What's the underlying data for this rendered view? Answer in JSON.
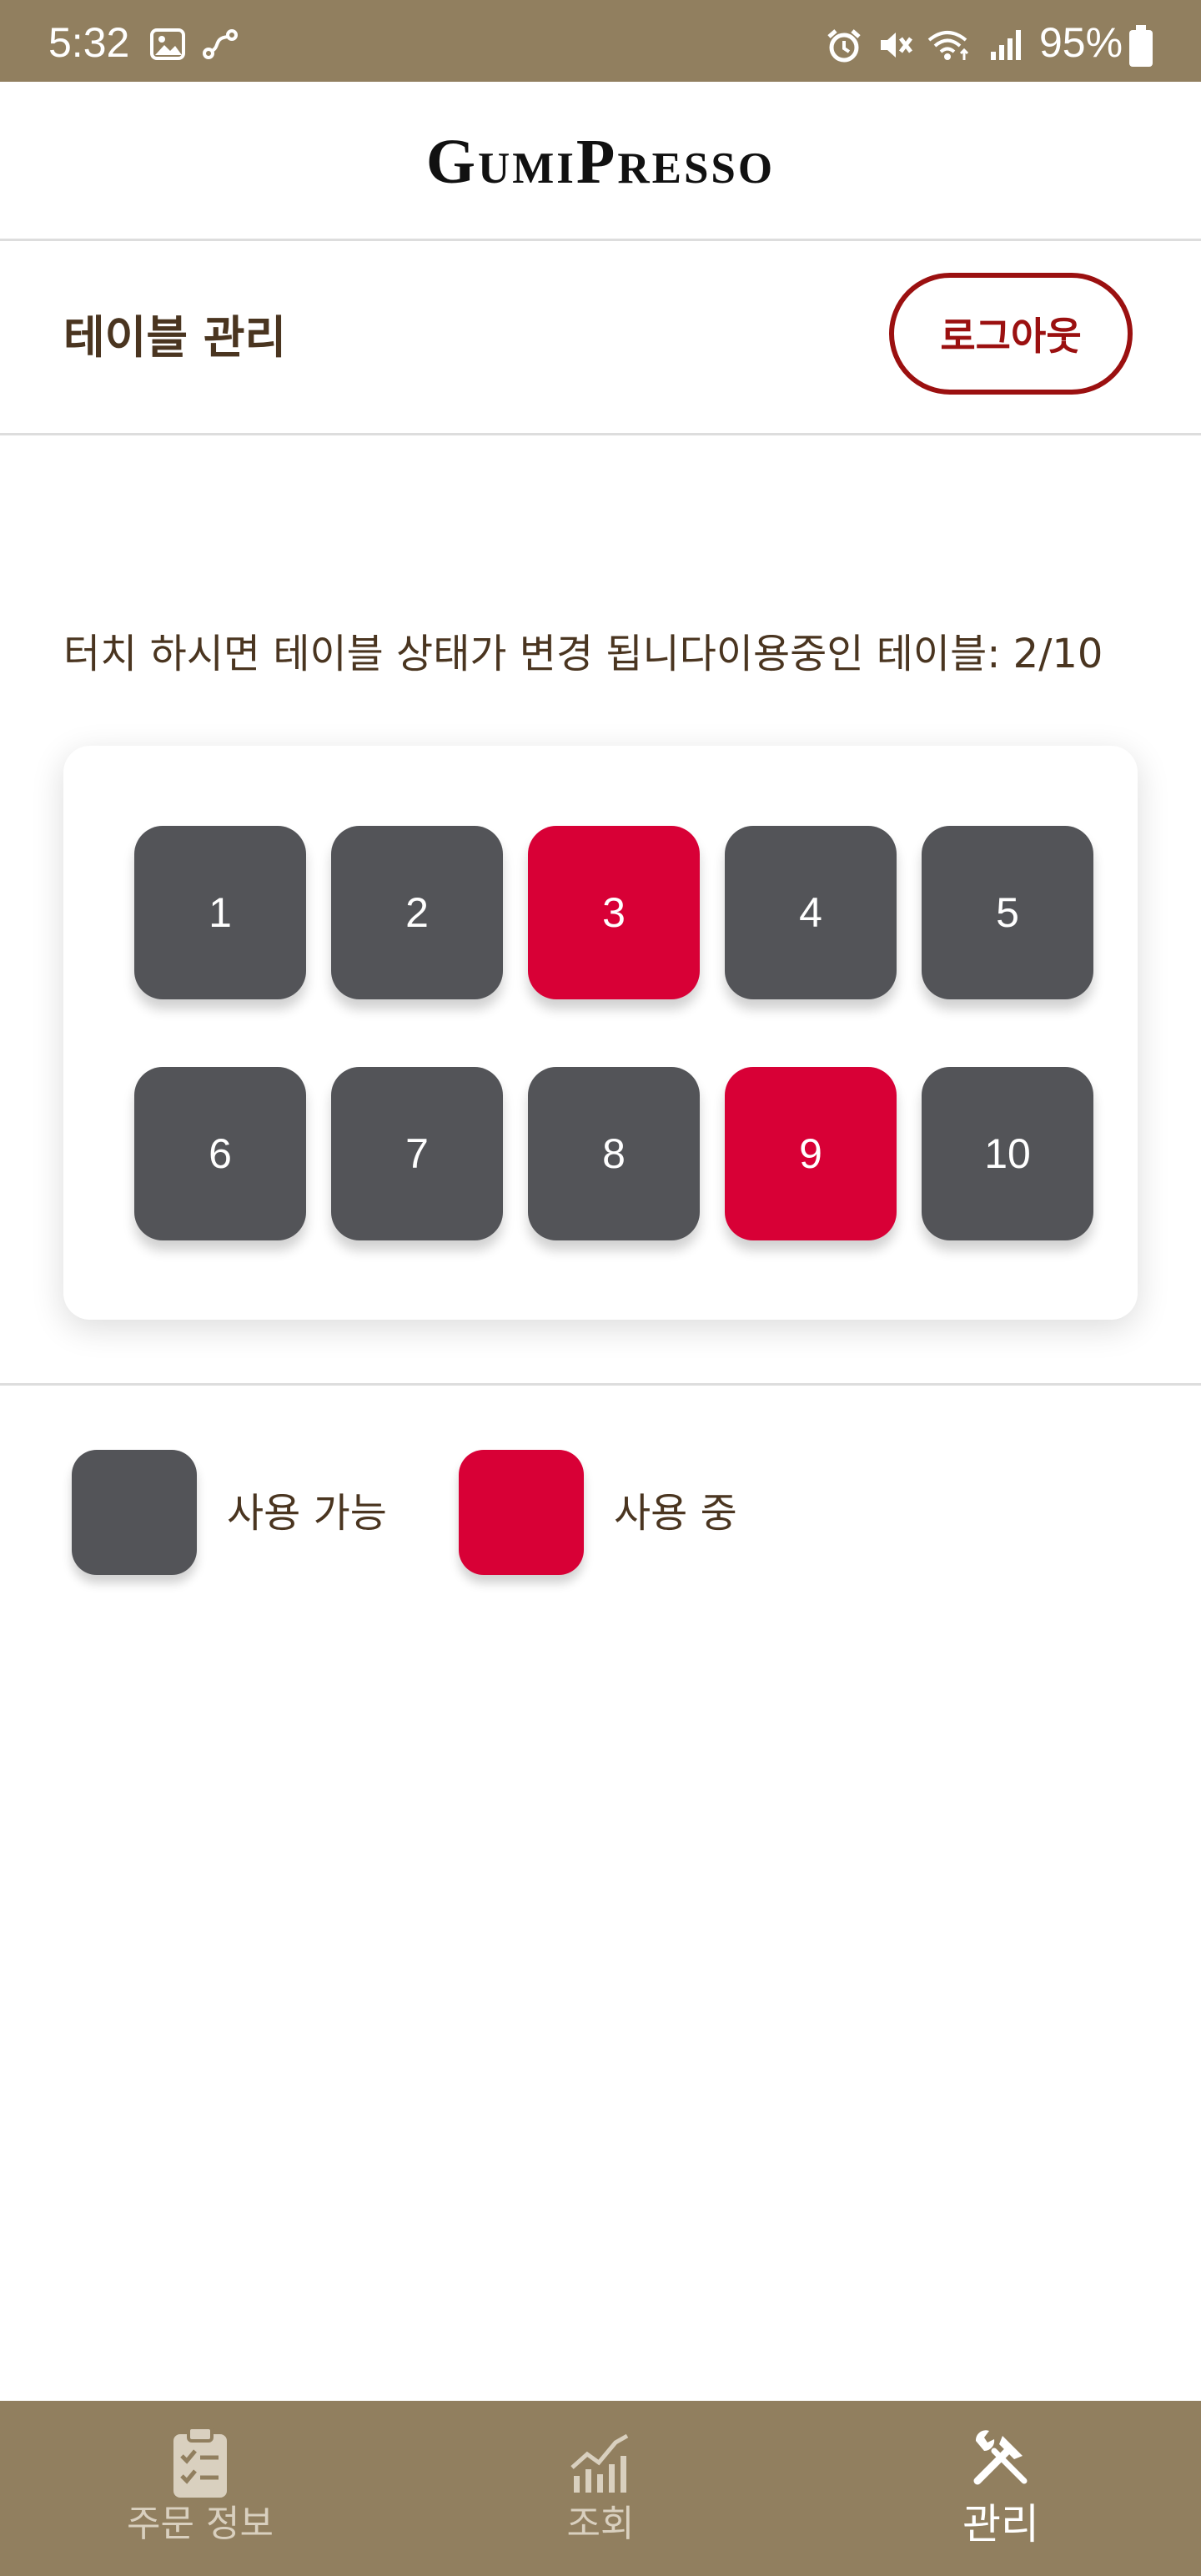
{
  "status_bar": {
    "time": "5:32",
    "battery": "95%",
    "icons": [
      "gallery-icon",
      "link-icon",
      "alarm-icon",
      "mute-icon",
      "wifi-icon",
      "signal-icon",
      "battery-icon"
    ]
  },
  "app": {
    "title": "GumiPresso"
  },
  "page": {
    "title": "테이블 관리",
    "logout_label": "로그아웃"
  },
  "info": {
    "text": "터치 하시면 테이블 상태가 변경 됩니다이용중인 테이블: 2/10"
  },
  "tables": [
    {
      "label": "1",
      "status": "available"
    },
    {
      "label": "2",
      "status": "available"
    },
    {
      "label": "3",
      "status": "occupied"
    },
    {
      "label": "4",
      "status": "available"
    },
    {
      "label": "5",
      "status": "available"
    },
    {
      "label": "6",
      "status": "available"
    },
    {
      "label": "7",
      "status": "available"
    },
    {
      "label": "8",
      "status": "available"
    },
    {
      "label": "9",
      "status": "occupied"
    },
    {
      "label": "10",
      "status": "available"
    }
  ],
  "legend": {
    "available_label": "사용 가능",
    "occupied_label": "사용 중"
  },
  "colors": {
    "brand": "#917f5f",
    "available": "#535458",
    "occupied": "#d80036",
    "logout": "#9b1010",
    "text": "#4a3520"
  },
  "nav": {
    "items": [
      {
        "label": "주문 정보",
        "icon": "clipboard-check-icon",
        "active": false
      },
      {
        "label": "조회",
        "icon": "chart-icon",
        "active": false
      },
      {
        "label": "관리",
        "icon": "tools-icon",
        "active": true
      }
    ]
  }
}
